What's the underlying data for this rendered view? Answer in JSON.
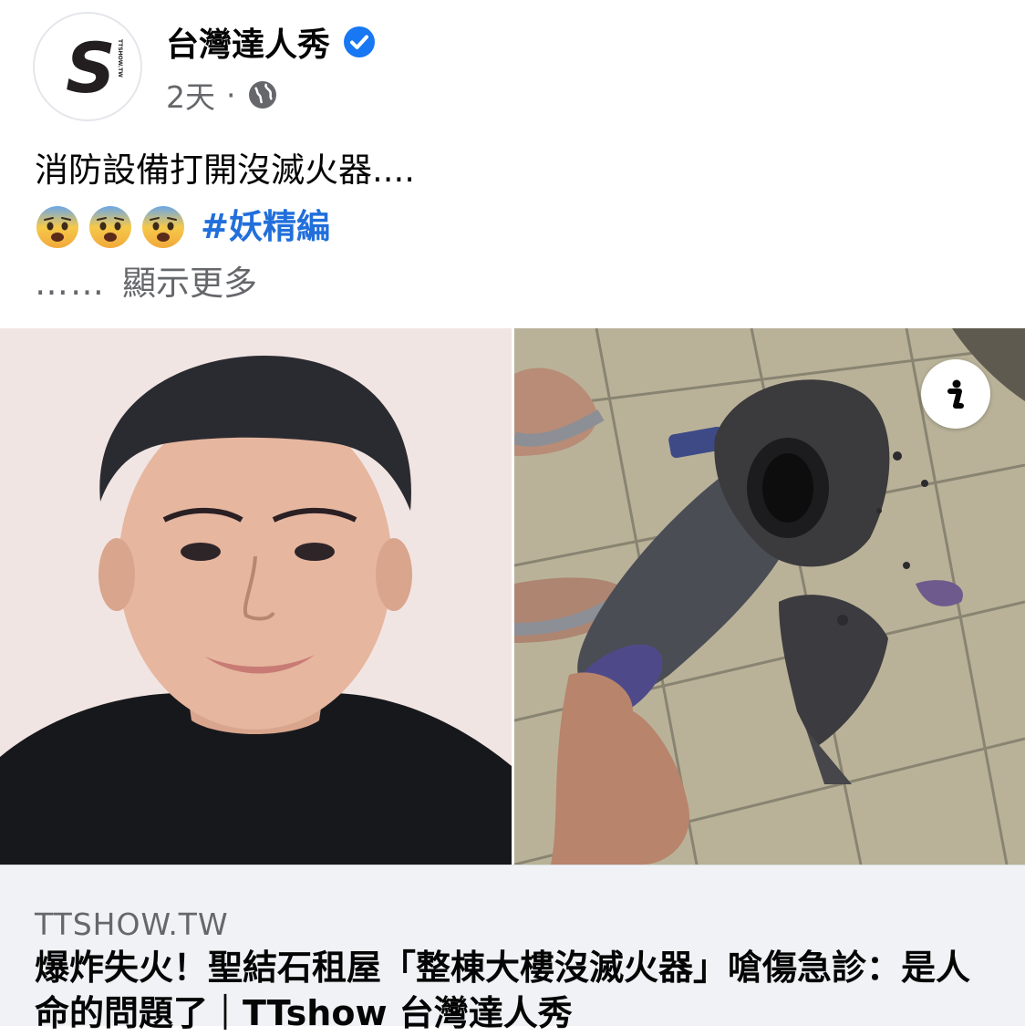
{
  "post": {
    "page_name": "台灣達人秀",
    "time": "2天",
    "separator": "·",
    "line1": "消防設備打開沒滅火器....",
    "hashtag": "#妖精編",
    "dots": "……",
    "see_more": "顯示更多"
  },
  "icons": {
    "avatar": "ttshow-logo",
    "verified": "verified-badge-icon",
    "privacy": "globe-icon",
    "emoji": "fearful-face-emoji",
    "info": "info-icon"
  },
  "avatar": {
    "letter": "S",
    "small_text": "TTSHOW.TW"
  },
  "link": {
    "domain": "TTSHOW.TW",
    "title": "爆炸失火！聖結石租屋「整棟大樓沒滅火器」嗆傷急診：是人命的問題了｜TTshow 台灣達人秀"
  },
  "colors": {
    "verified": "#1877f2",
    "hashtag": "#216fdb",
    "secondary_text": "#65676b",
    "card_bg": "#f0f2f5"
  }
}
